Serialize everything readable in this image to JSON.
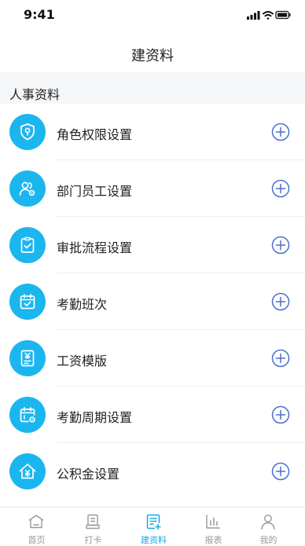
{
  "status_bar": {
    "time": "9:41"
  },
  "nav": {
    "title": "建资料"
  },
  "section": {
    "title": "人事资料"
  },
  "colors": {
    "accent": "#1bb6ee",
    "plus": "#4a6fd1",
    "tab_active": "#1aa7e8",
    "tab_inactive": "#999999"
  },
  "items": [
    {
      "label": "角色权限设置",
      "icon": "shield-icon"
    },
    {
      "label": "部门员工设置",
      "icon": "users-gear-icon"
    },
    {
      "label": "审批流程设置",
      "icon": "clipboard-check-icon"
    },
    {
      "label": "考勤班次",
      "icon": "calendar-check-icon"
    },
    {
      "label": "工资模版",
      "icon": "salary-doc-icon"
    },
    {
      "label": "考勤周期设置",
      "icon": "calendar-gear-icon"
    },
    {
      "label": "公积金设置",
      "icon": "house-yen-icon"
    }
  ],
  "tabs": [
    {
      "label": "首页",
      "icon": "home-icon",
      "active": false
    },
    {
      "label": "打卡",
      "icon": "punch-card-icon",
      "active": false
    },
    {
      "label": "建资料",
      "icon": "document-add-icon",
      "active": true
    },
    {
      "label": "报表",
      "icon": "bar-chart-icon",
      "active": false
    },
    {
      "label": "我的",
      "icon": "person-icon",
      "active": false
    }
  ]
}
